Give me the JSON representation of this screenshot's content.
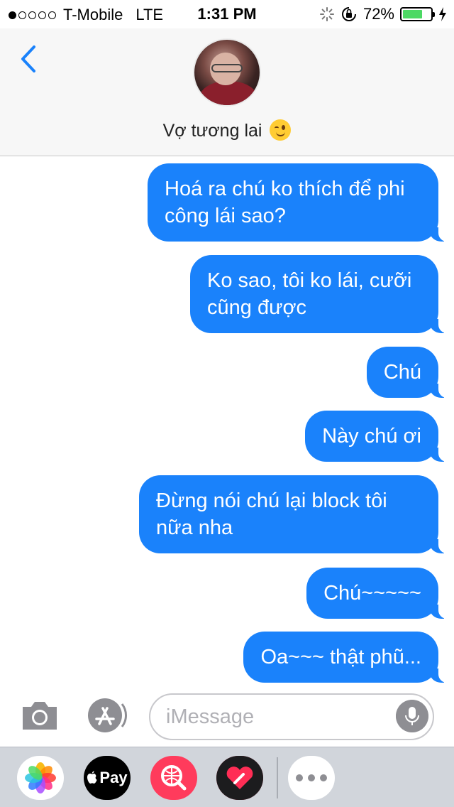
{
  "status_bar": {
    "carrier": "T-Mobile",
    "network": "LTE",
    "time": "1:31 PM",
    "battery_percent": "72%",
    "battery_level": 0.72
  },
  "header": {
    "contact_name": "Vợ tương lai",
    "back_icon": "chevron-left-icon"
  },
  "messages": [
    "Hoá ra chú ko thích để phi công lái sao?",
    "Ko sao, tôi ko lái, cưỡi cũng được",
    "Chú",
    "Này chú ơi",
    "Đừng nói chú lại block tôi nữa nha",
    "Chú~~~~~",
    "Oa~~~ thật phũ..."
  ],
  "composer": {
    "placeholder": "iMessage"
  },
  "app_drawer": {
    "pay_label": "Pay",
    "apps": [
      "photos-app-icon",
      "apple-pay-icon",
      "search-images-icon",
      "digital-touch-icon",
      "more-icon"
    ]
  },
  "colors": {
    "bubble": "#1a82fb",
    "accent": "#1a82fb",
    "drawer": "#d1d5db"
  }
}
